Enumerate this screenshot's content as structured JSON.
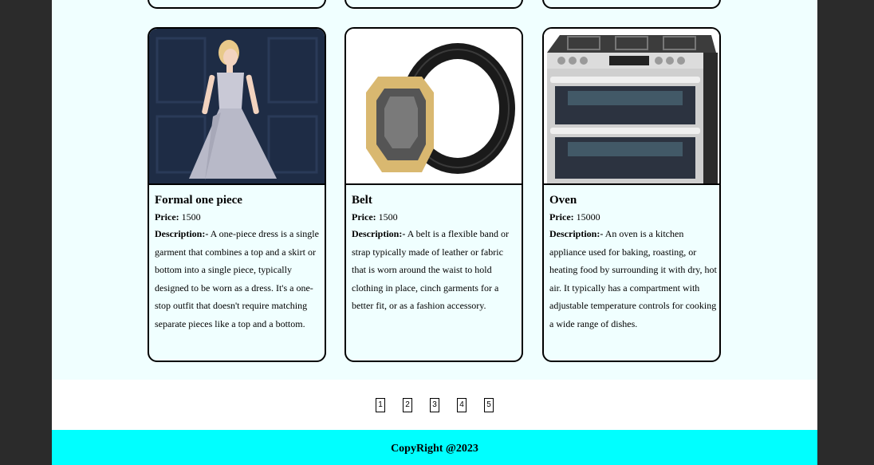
{
  "products": [
    {
      "title": "Formal one piece",
      "price_label": "Price:",
      "price": "1500",
      "desc_label": "Description:-",
      "description": "A one-piece dress is a single garment that combines a top and a skirt or bottom into a single piece, typically designed to be worn as a dress. It's a one-stop outfit that doesn't require matching separate pieces like a top and a bottom.",
      "image_icon": "dress-photo"
    },
    {
      "title": "Belt",
      "price_label": "Price:",
      "price": "1500",
      "desc_label": "Description:-",
      "description": "A belt is a flexible band or strap typically made of leather or fabric that is worn around the waist to hold clothing in place, cinch garments for a better fit, or as a fashion accessory.",
      "image_icon": "belt-photo"
    },
    {
      "title": "Oven",
      "price_label": "Price:",
      "price": "15000",
      "desc_label": "Description:-",
      "description": "An oven is a kitchen appliance used for baking, roasting, or heating food by surrounding it with dry, hot air. It typically has a compartment with adjustable temperature controls for cooking a wide range of dishes.",
      "image_icon": "oven-photo"
    }
  ],
  "pagination": [
    "1",
    "2",
    "3",
    "4",
    "5"
  ],
  "footer": {
    "text": "CopyRight @2023"
  },
  "colors": {
    "background": "#2b2b2b",
    "products_bg": "#f0ffff",
    "footer_bg": "#00ffff"
  }
}
